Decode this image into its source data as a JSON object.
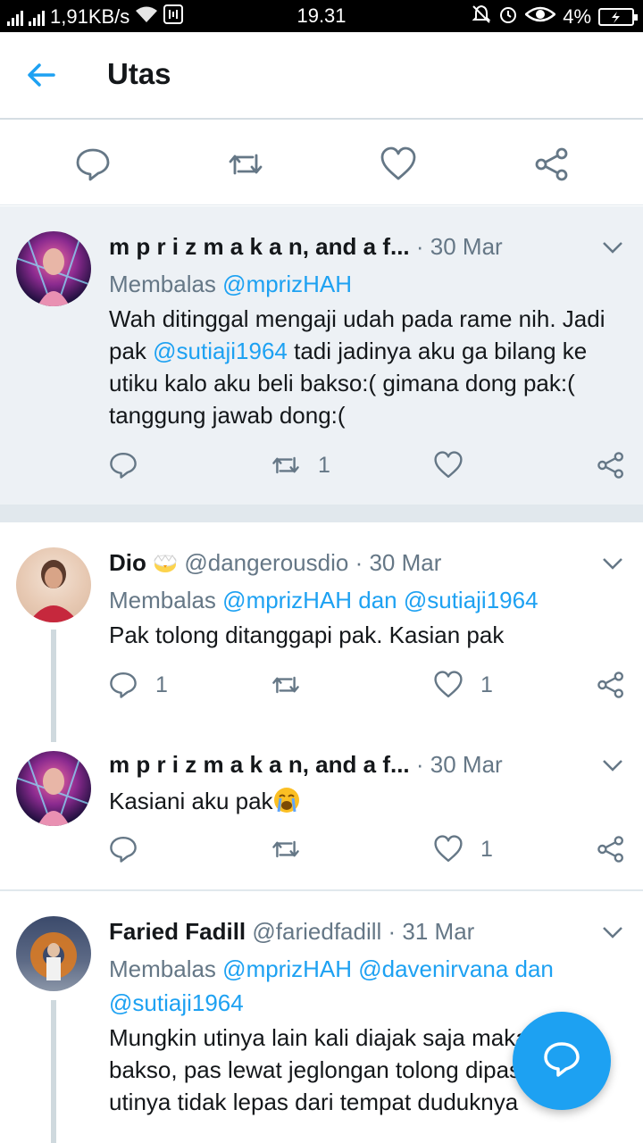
{
  "status_bar": {
    "network_speed": "1,91KB/s",
    "time": "19.31",
    "battery": "4%"
  },
  "app_bar": {
    "title": "Utas"
  },
  "tweets": [
    {
      "display_name": "m p r i z m a k a n, and a f...",
      "date": "· 30 Mar",
      "reply_label": "Membalas",
      "reply_to": "@mprizHAH",
      "text_parts": [
        "Wah ditinggal mengaji udah pada rame nih. Jadi pak ",
        "@sutiaji1964",
        " tadi jadinya aku ga bilang ke utiku kalo aku beli bakso:( gimana dong pak:( tanggung jawab dong:("
      ],
      "retweets": "1",
      "likes": ""
    },
    {
      "display_name": "Dio",
      "handle": "@dangerousdio",
      "date": "· 30 Mar",
      "reply_label": "Membalas",
      "reply_to": "@mprizHAH dan @sutiaji1964",
      "text": "Pak tolong ditanggapi pak. Kasian pak",
      "replies": "1",
      "likes": "1"
    },
    {
      "display_name": "m p r i z m a k a n, and a f...",
      "date": "· 30 Mar",
      "text": "Kasiani aku pak",
      "likes": "1"
    },
    {
      "display_name": "Faried Fadill",
      "handle": "@fariedfadill",
      "date": "· 31 Mar",
      "reply_label": "Membalas",
      "reply_to_line1": "@mprizHAH @davenirvana dan",
      "reply_to_line2": "@sutiaji1964",
      "text": "Mungkin utinya lain kali diajak saja makan bakso, pas lewat jeglongan tolong dipastikan utinya tidak lepas dari tempat duduknya"
    }
  ],
  "colors": {
    "accent": "#1da1f2",
    "muted": "#657786",
    "focus_bg": "#edf1f5"
  }
}
